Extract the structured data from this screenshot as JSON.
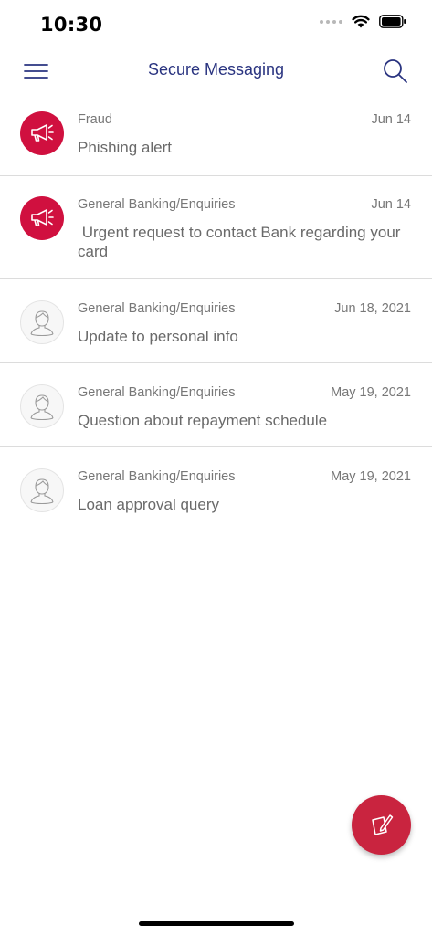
{
  "status_bar": {
    "time": "10:30"
  },
  "header": {
    "title": "Secure Messaging"
  },
  "messages": [
    {
      "category": "Fraud",
      "date": "Jun 14",
      "subject": "Phishing alert",
      "avatar": "megaphone-icon"
    },
    {
      "category": "General Banking/Enquiries",
      "date": "Jun 14",
      "subject": " Urgent request to contact Bank regarding your card",
      "avatar": "megaphone-icon"
    },
    {
      "category": "General Banking/Enquiries",
      "date": "Jun 18, 2021",
      "subject": "Update to personal info",
      "avatar": "user-avatar-icon"
    },
    {
      "category": "General Banking/Enquiries",
      "date": "May 19, 2021",
      "subject": "Question about repayment schedule",
      "avatar": "user-avatar-icon"
    },
    {
      "category": "General Banking/Enquiries",
      "date": "May 19, 2021",
      "subject": "Loan approval query",
      "avatar": "user-avatar-icon"
    }
  ],
  "colors": {
    "brand_navy": "#2a3480",
    "alert_red": "#d0103f",
    "compose_red": "#c9243f"
  },
  "icons": {
    "menu": "hamburger-menu-icon",
    "search": "search-icon",
    "compose": "compose-icon"
  }
}
